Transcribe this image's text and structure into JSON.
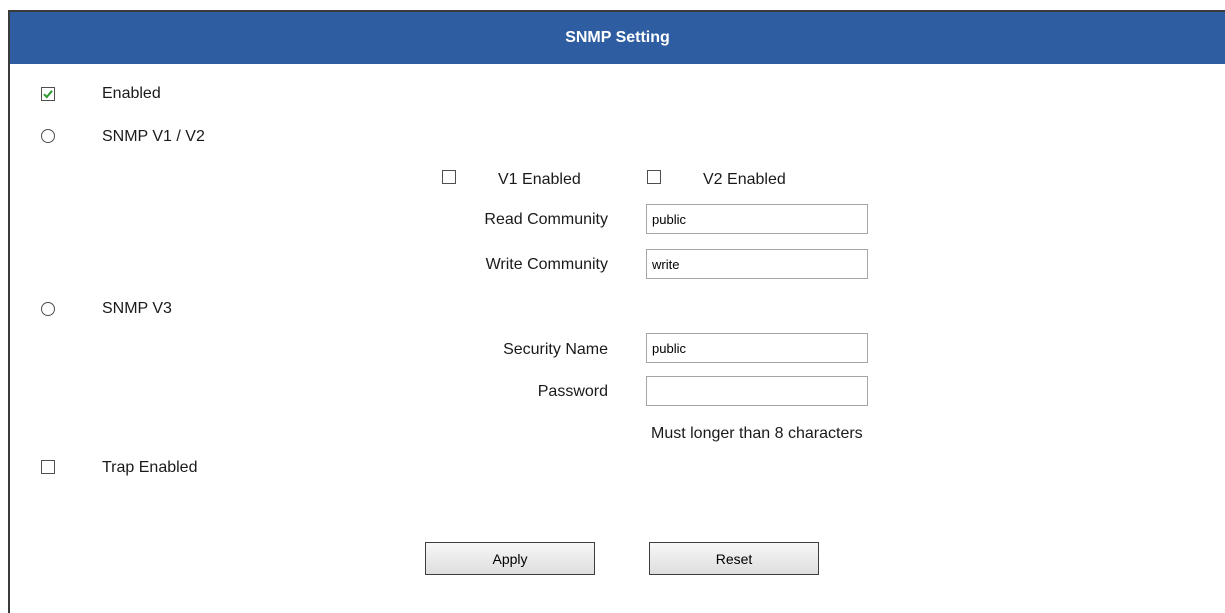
{
  "header": {
    "title": "SNMP Setting"
  },
  "enabled": {
    "label": "Enabled",
    "checked": true
  },
  "snmp_v1v2": {
    "label": "SNMP V1 / V2",
    "v1_label": "V1 Enabled",
    "v2_label": "V2 Enabled",
    "read_community_label": "Read Community",
    "read_community_value": "public",
    "write_community_label": "Write Community",
    "write_community_value": "write"
  },
  "snmp_v3": {
    "label": "SNMP V3",
    "security_name_label": "Security Name",
    "security_name_value": "public",
    "password_label": "Password",
    "password_value": "",
    "password_hint": "Must longer than 8 characters"
  },
  "trap": {
    "label": "Trap Enabled"
  },
  "buttons": {
    "apply": "Apply",
    "reset": "Reset"
  },
  "colors": {
    "header_bg": "#2f5da2",
    "check_mark": "#2e9a2e"
  }
}
